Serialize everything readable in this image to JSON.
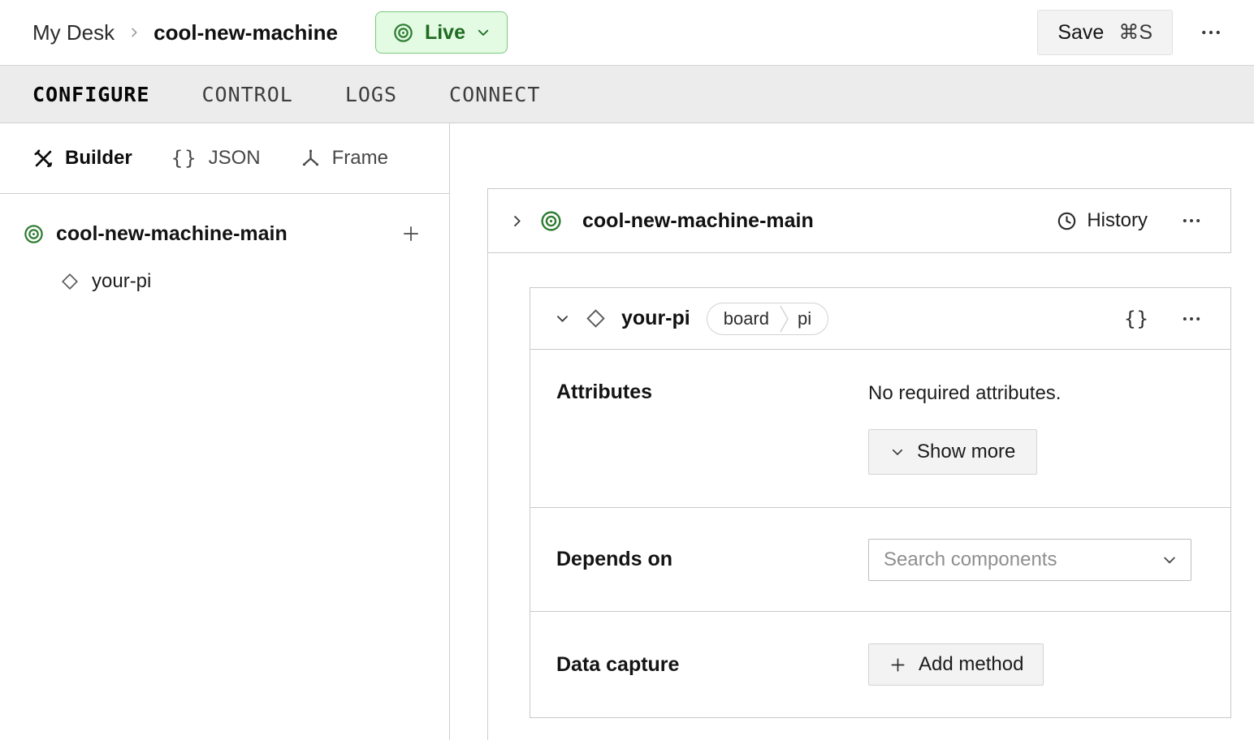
{
  "header": {
    "breadcrumb": {
      "parent": "My Desk",
      "current": "cool-new-machine"
    },
    "live": {
      "label": "Live"
    },
    "save": {
      "label": "Save",
      "shortcut": "⌘S"
    }
  },
  "tabs": [
    {
      "label": "CONFIGURE",
      "active": true
    },
    {
      "label": "CONTROL",
      "active": false
    },
    {
      "label": "LOGS",
      "active": false
    },
    {
      "label": "CONNECT",
      "active": false
    }
  ],
  "sidebar": {
    "modes": [
      {
        "label": "Builder",
        "icon": "tools-icon",
        "active": true
      },
      {
        "label": "JSON",
        "icon": "braces-icon",
        "glyph": "{}",
        "active": false
      },
      {
        "label": "Frame",
        "icon": "frame-axes-icon",
        "active": false
      }
    ],
    "tree": {
      "root": {
        "label": "cool-new-machine-main",
        "icon": "machine-part-icon",
        "add_glyph": "+"
      },
      "child": {
        "label": "your-pi",
        "icon": "component-diamond-icon"
      }
    }
  },
  "main": {
    "part_card": {
      "title": "cool-new-machine-main",
      "history_label": "History"
    },
    "component_card": {
      "title": "your-pi",
      "type_badge": "board",
      "model_badge": "pi",
      "braces_glyph": "{}",
      "sections": {
        "attributes": {
          "label": "Attributes",
          "empty_text": "No required attributes.",
          "show_more_label": "Show more"
        },
        "depends_on": {
          "label": "Depends on",
          "search_placeholder": "Search components"
        },
        "data_capture": {
          "label": "Data capture",
          "add_method_label": "Add method"
        }
      }
    }
  },
  "colors": {
    "accent_green": "#2f7d32",
    "live_badge_bg": "#e3fae3",
    "live_badge_border": "#7bc97d",
    "live_badge_text": "#1e6b21",
    "tab_bar_bg": "#ececec",
    "card_border": "#c9c9c9"
  }
}
